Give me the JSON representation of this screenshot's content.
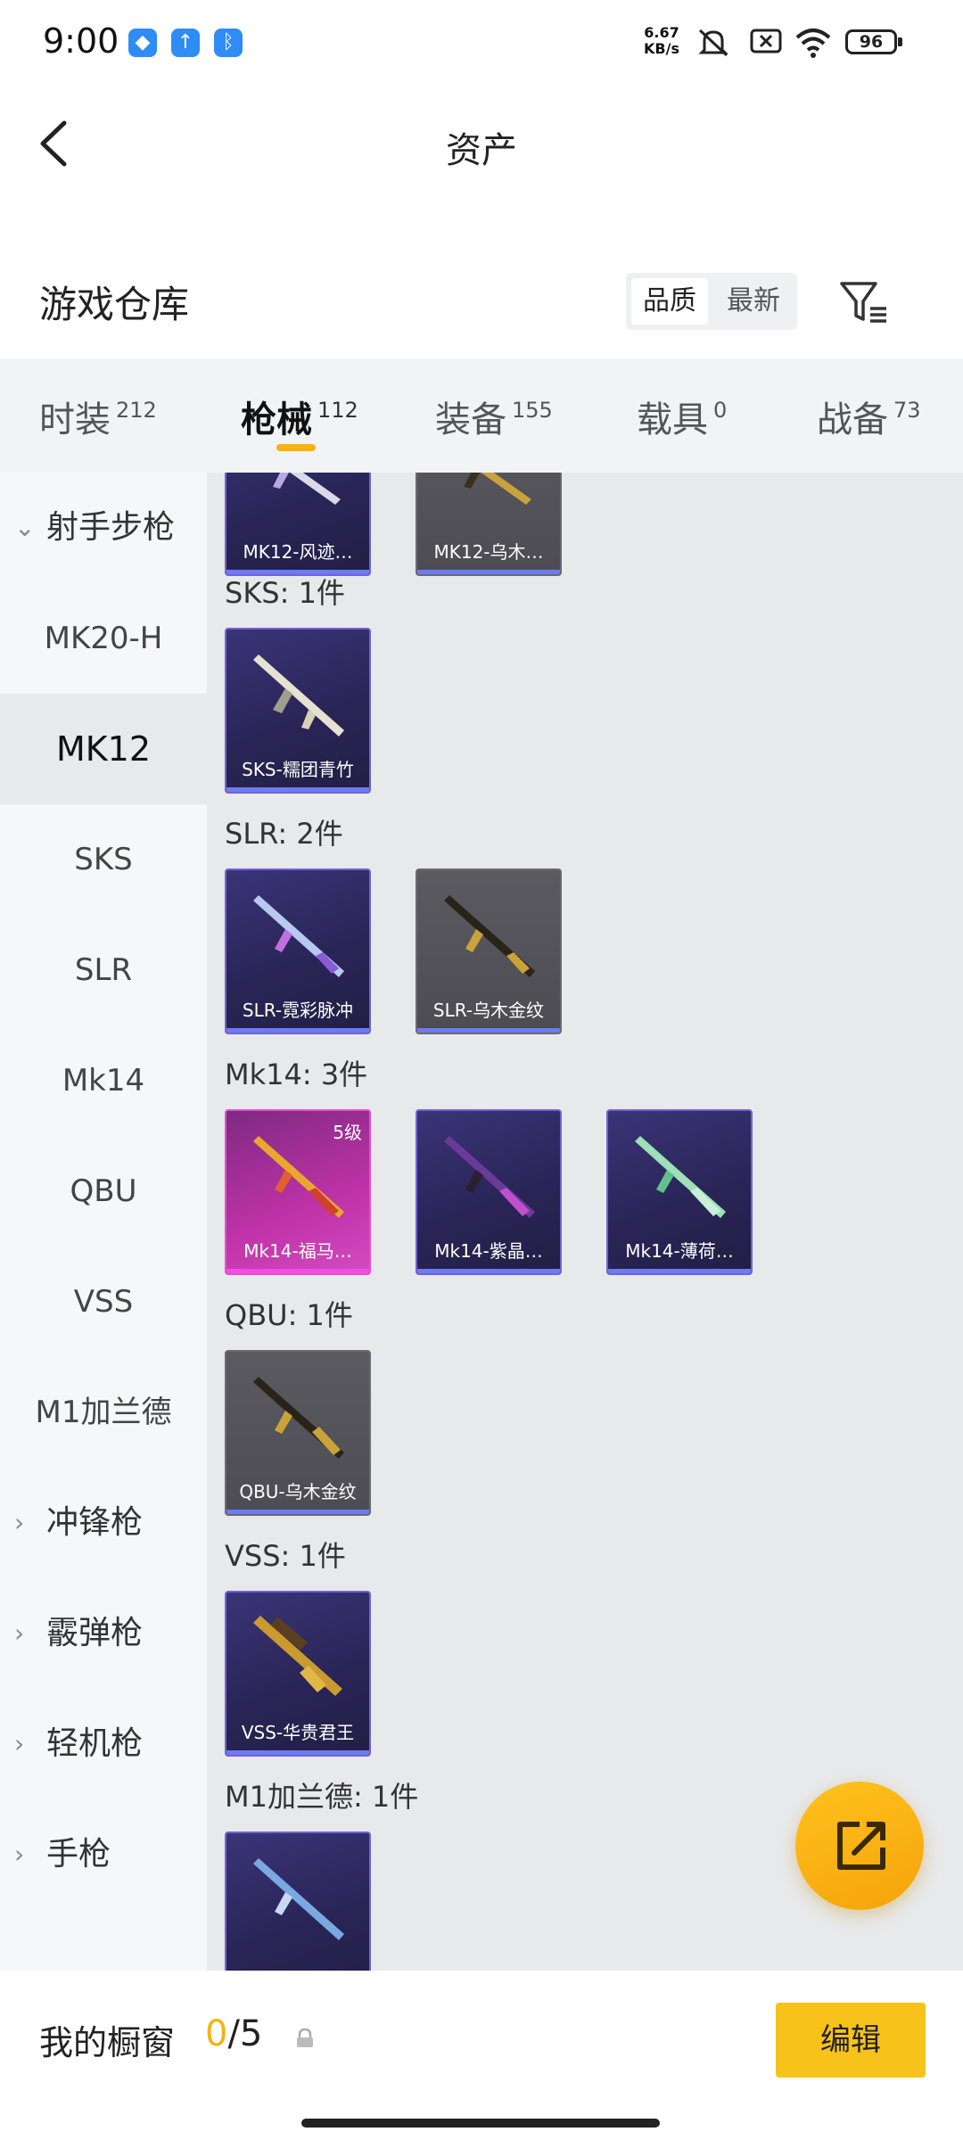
{
  "status_bar": {
    "time": "9:00",
    "net_speed_value": "6.67",
    "net_speed_unit": "KB/s",
    "battery": "96"
  },
  "header": {
    "title": "资产"
  },
  "warehouse": {
    "title": "游戏仓库",
    "sort_options": [
      "品质",
      "最新"
    ]
  },
  "tabs": [
    {
      "label": "时装",
      "count": "212"
    },
    {
      "label": "枪械",
      "count": "112"
    },
    {
      "label": "装备",
      "count": "155"
    },
    {
      "label": "载具",
      "count": "0"
    },
    {
      "label": "战备",
      "count": "73"
    }
  ],
  "sidebar": {
    "group_open": "射手步枪",
    "items": [
      "MK20-H",
      "MK12",
      "SKS",
      "SLR",
      "Mk14",
      "QBU",
      "VSS",
      "M1加兰德"
    ],
    "groups_closed": [
      "冲锋枪",
      "霰弹枪",
      "轻机枪",
      "手枪"
    ]
  },
  "content": {
    "top_cards": [
      "MK12-风迹…",
      "MK12-乌木…"
    ],
    "sections": [
      {
        "title": "SKS: 1件",
        "cards": [
          "SKS-糯团青竹"
        ]
      },
      {
        "title": "SLR: 2件",
        "cards": [
          "SLR-霓彩脉冲",
          "SLR-乌木金纹"
        ]
      },
      {
        "title": "Mk14: 3件",
        "cards": [
          "Mk14-福马…",
          "Mk14-紫晶…",
          "Mk14-薄荷…"
        ],
        "level": "5级"
      },
      {
        "title": "QBU: 1件",
        "cards": [
          "QBU-乌木金纹"
        ]
      },
      {
        "title": "VSS: 1件",
        "cards": [
          "VSS-华贵君王"
        ]
      },
      {
        "title": "M1加兰德: 1件",
        "cards": []
      }
    ]
  },
  "bottom_bar": {
    "label": "我的橱窗",
    "count_current": "0",
    "count_total": "/5",
    "edit_label": "编辑"
  }
}
